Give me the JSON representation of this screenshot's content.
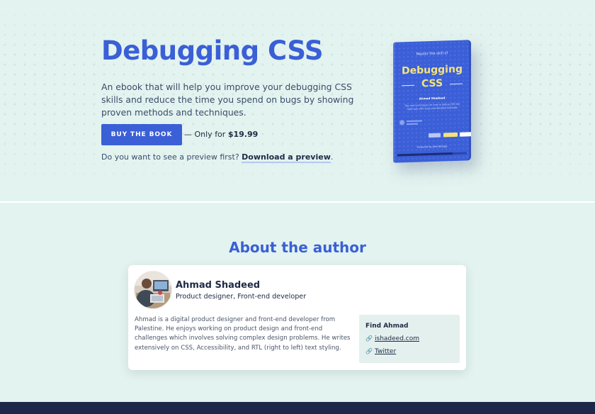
{
  "hero": {
    "title": "Debugging CSS",
    "description": "An ebook that will help you improve your debugging CSS skills and reduce the time you spend on bugs by showing proven methods and techniques.",
    "buy_label": "BUY THE BOOK",
    "price_prefix": "— Only for ",
    "price": "$19.99",
    "preview_prompt": "Do you want to see a preview first? ",
    "preview_link": "Download a preview",
    "preview_suffix": "."
  },
  "book_cover": {
    "kicker": "Master the skill of",
    "title_line1": "Debugging",
    "title_line2": "CSS",
    "author": "Ahmad Shadeed",
    "tagline": "Tips and techniques on how to debug CSS the right way with easy and detailed methods",
    "foreword": "Foreword by John Allsopp",
    "colors": {
      "cover": "#3b5fd8",
      "title": "#f5e37a"
    }
  },
  "about": {
    "title": "About the author",
    "author_name": "Ahmad Shadeed",
    "author_role": "Product designer, Front-end developer",
    "bio": "Ahmad is a digital product designer and front-end developer from Palestine. He enjoys working on product design and front-end challenges which involves solving complex design problems. He writes extensively on CSS, Accessibility, and RTL (right to left) text styling.",
    "find": {
      "title": "Find Ahmad",
      "links": [
        {
          "label": "ishadeed.com",
          "icon": "link-icon"
        },
        {
          "label": "Twitter",
          "icon": "link-icon"
        }
      ]
    }
  },
  "colors": {
    "accent": "#3a5fd6",
    "background": "#e3f3ef",
    "footer": "#1d2749"
  }
}
